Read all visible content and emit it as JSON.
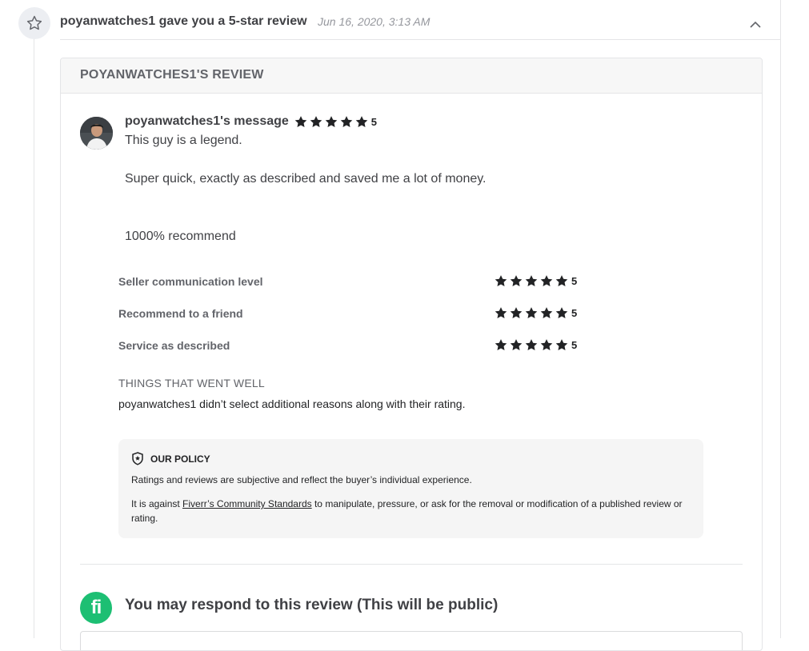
{
  "header": {
    "summary": "poyanwatches1 gave you a 5-star review",
    "date": "Jun 16, 2020, 3:13 AM",
    "icon": "star-icon",
    "collapse_icon": "chevron-up-icon"
  },
  "card": {
    "title": "POYANWATCHES1'S REVIEW"
  },
  "message": {
    "author_heading": "poyanwatches1's message",
    "rating": 5,
    "rating_label": "5",
    "lines": [
      "This guy is a legend.",
      "Super quick, exactly as described and saved me a lot of money.",
      "1000% recommend"
    ]
  },
  "categories": [
    {
      "label": "Seller communication level",
      "rating": 5,
      "rating_label": "5"
    },
    {
      "label": "Recommend to a friend",
      "rating": 5,
      "rating_label": "5"
    },
    {
      "label": "Service as described",
      "rating": 5,
      "rating_label": "5"
    }
  ],
  "went_well": {
    "title": "THINGS THAT WENT WELL",
    "text": "poyanwatches1 didn’t select additional reasons along with their rating."
  },
  "policy": {
    "title": "OUR POLICY",
    "line1": "Ratings and reviews are subjective and reflect the buyer’s individual experience.",
    "line2_prefix": "It is against ",
    "line2_link": "Fiverr’s Community Standards",
    "line2_suffix": " to manipulate, pressure, or ask for the removal or modification of a published review or rating."
  },
  "respond": {
    "logo_text": "fi",
    "title": "You may respond to this review (This will be public)"
  },
  "colors": {
    "brand_green": "#1dbf73",
    "star_color": "#222325"
  }
}
